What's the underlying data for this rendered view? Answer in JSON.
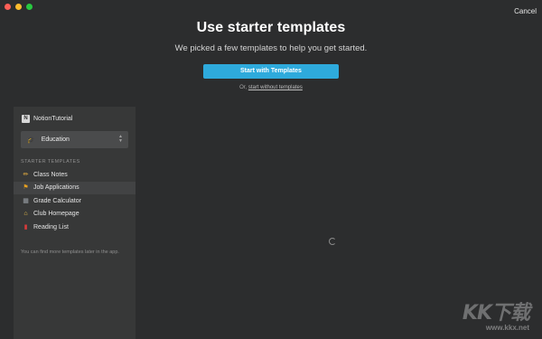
{
  "window": {
    "cancel_label": "Cancel"
  },
  "header": {
    "title": "Use starter templates",
    "subtitle": "We picked a few templates to help you get started.",
    "primary_button_label": "Start with Templates",
    "skip_prefix": "Or,",
    "skip_link_label": "start without templates"
  },
  "sidebar": {
    "workspace_icon_letter": "N",
    "workspace_name": "NotionTutorial",
    "category_select": {
      "icon": "graduation-cap-icon",
      "value": "Education"
    },
    "section_label": "STARTER TEMPLATES",
    "templates": [
      {
        "icon": "pencil-icon",
        "glyph": "✏",
        "color": "#f0b440",
        "label": "Class Notes"
      },
      {
        "icon": "flag-icon",
        "glyph": "⚑",
        "color": "#e6a020",
        "label": "Job Applications"
      },
      {
        "icon": "calculator-icon",
        "glyph": "▦",
        "color": "#9aa0a6",
        "label": "Grade Calculator"
      },
      {
        "icon": "house-icon",
        "glyph": "⌂",
        "color": "#f2c44c",
        "label": "Club Homepage"
      },
      {
        "icon": "red-book-icon",
        "glyph": "▮",
        "color": "#d83b3b",
        "label": "Reading List"
      }
    ],
    "footnote": "You can find more templates later in the app."
  },
  "watermark": {
    "logo_text": "KK下载",
    "url": "www.kkx.net"
  },
  "colors": {
    "accent": "#2eaadc",
    "background": "#2c2d2e",
    "sidebar": "#373838"
  }
}
